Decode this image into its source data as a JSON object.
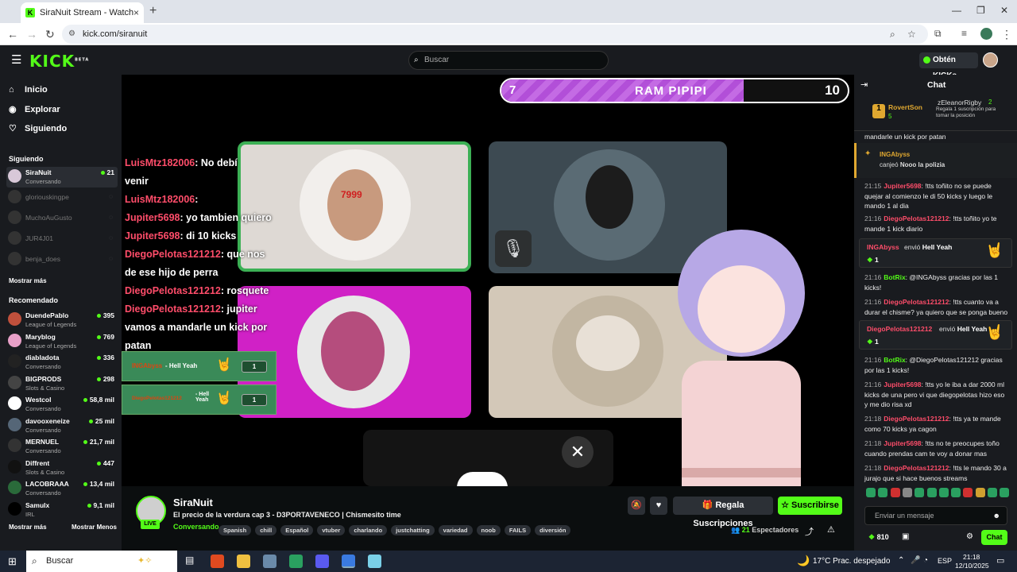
{
  "browser": {
    "tab_title": "SiraNuit Stream - Watch Live o",
    "tab_close": "×",
    "new_tab": "+",
    "url": "kick.com/siranuit",
    "win_min": "—",
    "win_max": "❐",
    "win_close": "✕"
  },
  "header": {
    "logo": "KICK",
    "logo_badge": "BETA",
    "search_placeholder": "Buscar",
    "kicks_button": "Obtén KICKs"
  },
  "sidebar": {
    "nav": [
      {
        "label": "Inicio",
        "icon": "home-icon"
      },
      {
        "label": "Explorar",
        "icon": "compass-icon"
      },
      {
        "label": "Siguiendo",
        "icon": "heart-icon"
      }
    ],
    "following_title": "Siguiendo",
    "following": [
      {
        "name": "SiraNuit",
        "category": "Conversando",
        "viewers": "21",
        "online": true
      },
      {
        "name": "gloriouskingpe",
        "online": false
      },
      {
        "name": "MuchoAuGusto",
        "online": false
      },
      {
        "name": "JUR4J01",
        "online": false
      },
      {
        "name": "benja_does",
        "online": false
      }
    ],
    "show_more": "Mostrar más",
    "recommended_title": "Recomendado",
    "recommended": [
      {
        "name": "DuendePablo",
        "category": "League of Legends",
        "viewers": "395",
        "color": "#c0503c"
      },
      {
        "name": "Maryblog",
        "category": "League of Legends",
        "viewers": "769",
        "color": "#e8a0c8"
      },
      {
        "name": "diabladota",
        "category": "Conversando",
        "viewers": "336",
        "color": "#222222"
      },
      {
        "name": "BIGPRODS",
        "category": "Slots & Casino",
        "viewers": "298",
        "color": "#444444"
      },
      {
        "name": "Westcol",
        "category": "Conversando",
        "viewers": "58,8 mil",
        "color": "#ffffff"
      },
      {
        "name": "davooxeneize",
        "category": "Conversando",
        "viewers": "25 mil",
        "color": "#556677"
      },
      {
        "name": "MERNUEL",
        "category": "Conversando",
        "viewers": "21,7 mil",
        "color": "#333333"
      },
      {
        "name": "Diffrent",
        "category": "Slots & Casino",
        "viewers": "447",
        "color": "#111111"
      },
      {
        "name": "LACOBRAAA",
        "category": "Conversando",
        "viewers": "13,4 mil",
        "color": "#2a6a3a"
      },
      {
        "name": "Samulx",
        "category": "IRL",
        "viewers": "9,1 mil",
        "color": "#000000"
      }
    ],
    "show_more2": "Mostrar más",
    "show_less": "Mostrar Menos"
  },
  "video": {
    "bar_left": "7",
    "bar_title": "RAM PIPIPI",
    "bar_right": "10",
    "bar_progress": 0.7,
    "overlay_chat": [
      {
        "user": "LuisMtz182006",
        "text": ": No debí"
      },
      {
        "user": "",
        "text": "venir"
      },
      {
        "user": "LuisMtz182006",
        "text": ":"
      },
      {
        "user": "Jupiter5698",
        "text": ": yo tambien quiero"
      },
      {
        "user": "Jupiter5698",
        "text": ": di 10 kicks"
      },
      {
        "user": "DiegoPelotas121212",
        "text": ": que nos"
      },
      {
        "user": "",
        "text": "de ese hijo de perra"
      },
      {
        "user": "DiegoPelotas121212",
        "text": ": rosquete"
      },
      {
        "user": "DiegoPelotas121212",
        "text": ": jupiter"
      },
      {
        "user": "",
        "text": "vamos a mandarle un kick por"
      },
      {
        "user": "",
        "text": "patan"
      }
    ],
    "alerts": [
      {
        "user": "INGAbyss",
        "text": "- Hell Yeah",
        "count": "1"
      },
      {
        "user": "DiegoPelotas121212",
        "text": "- Hell Yeah",
        "count": "1"
      }
    ],
    "cam_number": "7999"
  },
  "stream": {
    "channel": "SiraNuit",
    "live": "LIVE",
    "title": "El precio de la verdura cap 3 - D3PORTAVENECO | Chismesito time",
    "category": "Conversando",
    "tags": [
      "Spanish",
      "chill",
      "Español",
      "vtuber",
      "charlando",
      "justchatting",
      "variedad",
      "noob",
      "FAILS",
      "diversión"
    ],
    "gift_button": "Regala Suscripciones",
    "subscribe_button": "Suscribirse",
    "viewers": "21",
    "viewers_label": "Espectadores"
  },
  "chat": {
    "title": "Chat",
    "leader1_name": "RovertSon",
    "leader1_count": "5",
    "leader2_name": "zEleanorRigby",
    "leader2_count": "2",
    "leader2_hint": "Regala 1 suscripción para tomar la posición",
    "partial_msg": "mandarle un kick por patan",
    "redeem_user": "INGAbyss",
    "redeem_text": "canjeó",
    "redeem_item": "Nooo la polizia",
    "messages": [
      {
        "time": "21:15",
        "user": "Jupiter5698",
        "color": "#ff4d6a",
        "text": "!tts toñito no se puede quejar al comienzo le di 50 kicks y luego le mando 1 al dia"
      },
      {
        "time": "21:16",
        "user": "DiegoPelotas121212",
        "color": "#ff4d6a",
        "text": "!tts toñito yo te mande 1 kick diario"
      }
    ],
    "gift1_user": "INGAbyss",
    "gift1_text": "envió",
    "gift1_item": "Hell Yeah",
    "gift1_count": "1",
    "messages2": [
      {
        "time": "21:16",
        "user": "BotRix",
        "color": "#53fc18",
        "text": "@INGAbyss gracias por las 1 kicks!"
      },
      {
        "time": "21:16",
        "user": "DiegoPelotas121212",
        "color": "#ff4d6a",
        "text": "!tts cuanto va a durar el chisme? ya quiero que se ponga bueno"
      }
    ],
    "gift2_user": "DiegoPelotas121212",
    "gift2_text": "envió",
    "gift2_item": "Hell Yeah",
    "gift2_count": "1",
    "messages3": [
      {
        "time": "21:16",
        "user": "BotRix",
        "color": "#53fc18",
        "text": "@DiegoPelotas121212 gracias por las 1 kicks!"
      },
      {
        "time": "21:16",
        "user": "Jupiter5698",
        "color": "#ff4d6a",
        "text": "!tts yo le iba a dar 2000 ml kicks de una pero vi que diegopelotas hizo eso y me dio risa xd"
      },
      {
        "time": "21:18",
        "user": "DiegoPelotas121212",
        "color": "#ff4d6a",
        "text": "!tts ya te mande como 70 kicks ya cagon"
      },
      {
        "time": "21:18",
        "user": "Jupiter5698",
        "color": "#ff4d6a",
        "text": "!tts no te preocupes toño cuando prendas cam te voy a donar mas"
      },
      {
        "time": "21:18",
        "user": "DiegoPelotas121212",
        "color": "#ff4d6a",
        "text": "!tts le mando 30 a jurajo que si hace buenos streams"
      }
    ],
    "input_placeholder": "Enviar un mensaje",
    "points": "810",
    "send_button": "Chat"
  },
  "taskbar": {
    "search": "Buscar",
    "weather": "17°C  Prac. despejado",
    "lang": "ESP",
    "time": "21:18",
    "date": "12/10/2025"
  }
}
